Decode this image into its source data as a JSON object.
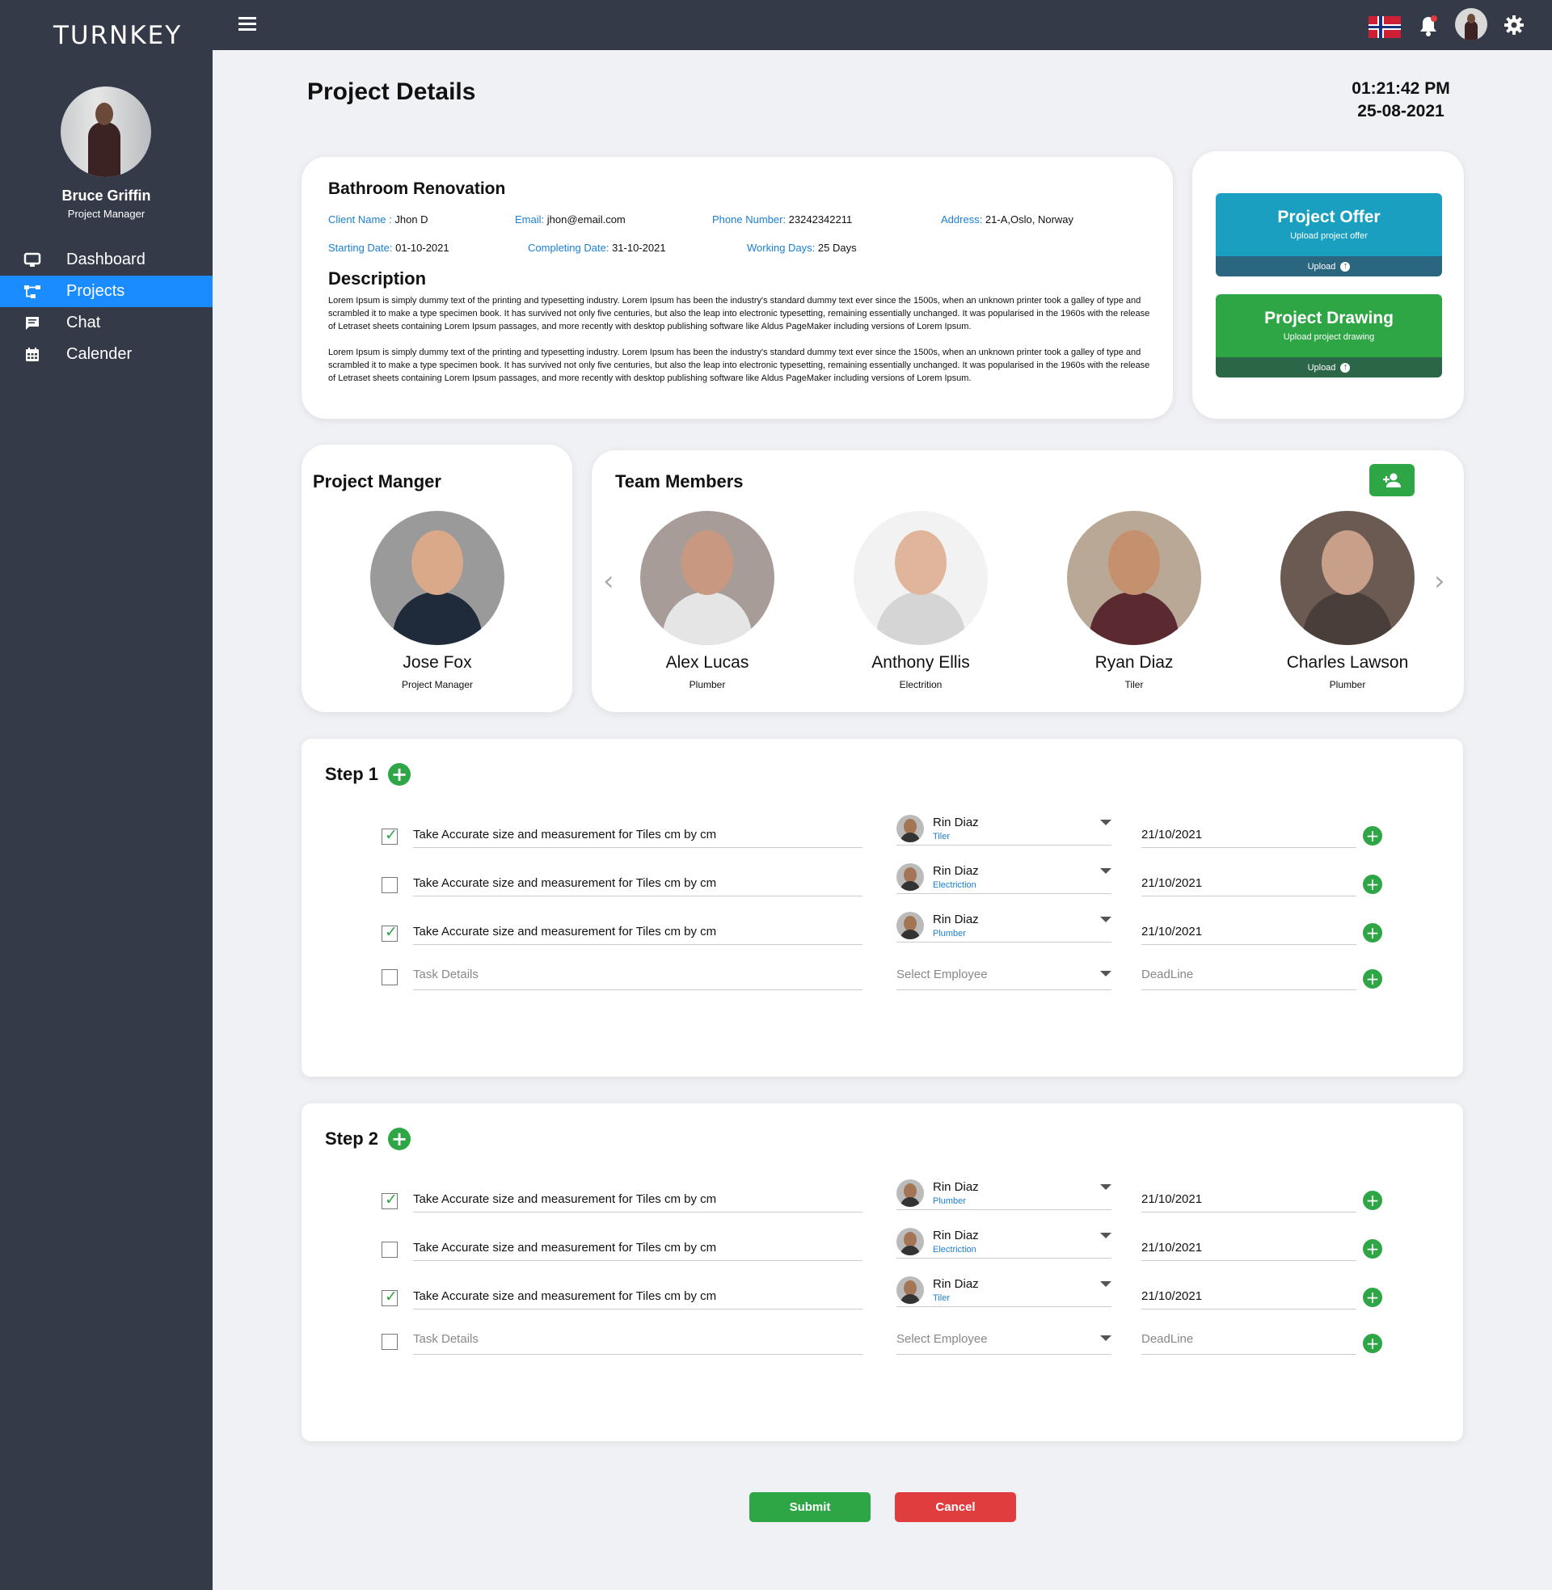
{
  "app": {
    "logo": "TURNKEY"
  },
  "sidebar": {
    "user": {
      "name": "Bruce Griffin",
      "role": "Project Manager"
    },
    "items": [
      {
        "label": "Dashboard",
        "icon": "monitor-icon"
      },
      {
        "label": "Projects",
        "icon": "projects-icon",
        "active": true
      },
      {
        "label": "Chat",
        "icon": "chat-icon"
      },
      {
        "label": "Calender",
        "icon": "calendar-icon"
      }
    ]
  },
  "topbar": {
    "icons": [
      "menu-icon",
      "norway-flag-icon",
      "bell-icon",
      "avatar",
      "gear-icon"
    ]
  },
  "page": {
    "title": "Project Details",
    "time": "01:21:42 PM",
    "date": "25-08-2021"
  },
  "project": {
    "name": "Bathroom Renovation",
    "client_label": "Client Name :",
    "client": " Jhon D",
    "email_label": "Email:",
    "email": " jhon@email.com",
    "phone_label": "Phone Number:",
    "phone": " 23242342211",
    "address_label": "Address:",
    "address": " 21-A,Oslo, Norway",
    "start_label": "Starting Date:",
    "start": " 01-10-2021",
    "end_label": "Completing Date:",
    "end": " 31-10-2021",
    "days_label": "Working Days:",
    "days": " 25 Days",
    "description_title": "Description",
    "description_1": "Lorem Ipsum is simply dummy text of the printing and typesetting industry. Lorem Ipsum has been the industry's standard dummy text ever since the 1500s, when an unknown printer took a galley of type and scrambled it to make a type specimen book. It has survived not only five centuries, but also the leap into electronic typesetting, remaining essentially unchanged. It was popularised in the 1960s with the release of Letraset sheets containing Lorem Ipsum passages, and more recently with desktop publishing software like Aldus PageMaker including versions of Lorem Ipsum.",
    "description_2": "Lorem Ipsum is simply dummy text of the printing and typesetting industry. Lorem Ipsum has been the industry's standard dummy text ever since the 1500s, when an unknown printer took a galley of type and scrambled it to make a type specimen book. It has survived not only five centuries, but also the leap into electronic typesetting, remaining essentially unchanged. It was popularised in the 1960s with the release of Letraset sheets containing Lorem Ipsum passages, and more recently with desktop publishing software like Aldus PageMaker including versions of Lorem Ipsum."
  },
  "uploads": {
    "offer": {
      "title": "Project Offer",
      "subtitle": "Upload project offer",
      "button": "Upload",
      "color": "#1a9fc0",
      "bar_color": "#2b6680"
    },
    "drawing": {
      "title": "Project Drawing",
      "subtitle": "Upload project drawing",
      "button": "Upload",
      "color": "#2ea645",
      "bar_color": "#2b6648"
    }
  },
  "manager": {
    "heading": "Project Manger",
    "name": "Jose Fox",
    "role": "Project Manager"
  },
  "team": {
    "heading": "Team Members",
    "members": [
      {
        "name": "Alex Lucas",
        "role": "Plumber"
      },
      {
        "name": "Anthony Ellis",
        "role": "Electrition"
      },
      {
        "name": "Ryan Diaz",
        "role": "Tiler"
      },
      {
        "name": "Charles Lawson",
        "role": "Plumber"
      }
    ]
  },
  "steps": [
    {
      "title": "Step 1",
      "tasks": [
        {
          "checked": true,
          "task": "Take Accurate size and measurement for Tiles cm by cm",
          "employee": "Rin Diaz",
          "emp_role": "Tiler",
          "deadline": "21/10/2021"
        },
        {
          "checked": false,
          "task": "Take Accurate size and measurement for Tiles cm by cm",
          "employee": "Rin Diaz",
          "emp_role": "Electriction",
          "deadline": "21/10/2021"
        },
        {
          "checked": true,
          "task": "Take Accurate size and measurement for Tiles cm by cm",
          "employee": "Rin Diaz",
          "emp_role": "Plumber",
          "deadline": "21/10/2021"
        }
      ],
      "new_row": {
        "task_placeholder": "Task Details",
        "employee_placeholder": "Select Employee",
        "deadline_placeholder": "DeadLine"
      }
    },
    {
      "title": "Step 2",
      "tasks": [
        {
          "checked": true,
          "task": "Take Accurate size and measurement for Tiles cm by cm",
          "employee": "Rin Diaz",
          "emp_role": "Plumber",
          "deadline": "21/10/2021"
        },
        {
          "checked": false,
          "task": "Take Accurate size and measurement for Tiles cm by cm",
          "employee": "Rin Diaz",
          "emp_role": "Electriction",
          "deadline": "21/10/2021"
        },
        {
          "checked": true,
          "task": "Take Accurate size and measurement for Tiles cm by cm",
          "employee": "Rin Diaz",
          "emp_role": "Tiler",
          "deadline": "21/10/2021"
        }
      ],
      "new_row": {
        "task_placeholder": "Task Details",
        "employee_placeholder": "Select Employee",
        "deadline_placeholder": "DeadLine"
      }
    }
  ],
  "actions": {
    "submit": "Submit",
    "cancel": "Cancel",
    "submit_color": "#2ea645",
    "cancel_color": "#e03e3e"
  }
}
